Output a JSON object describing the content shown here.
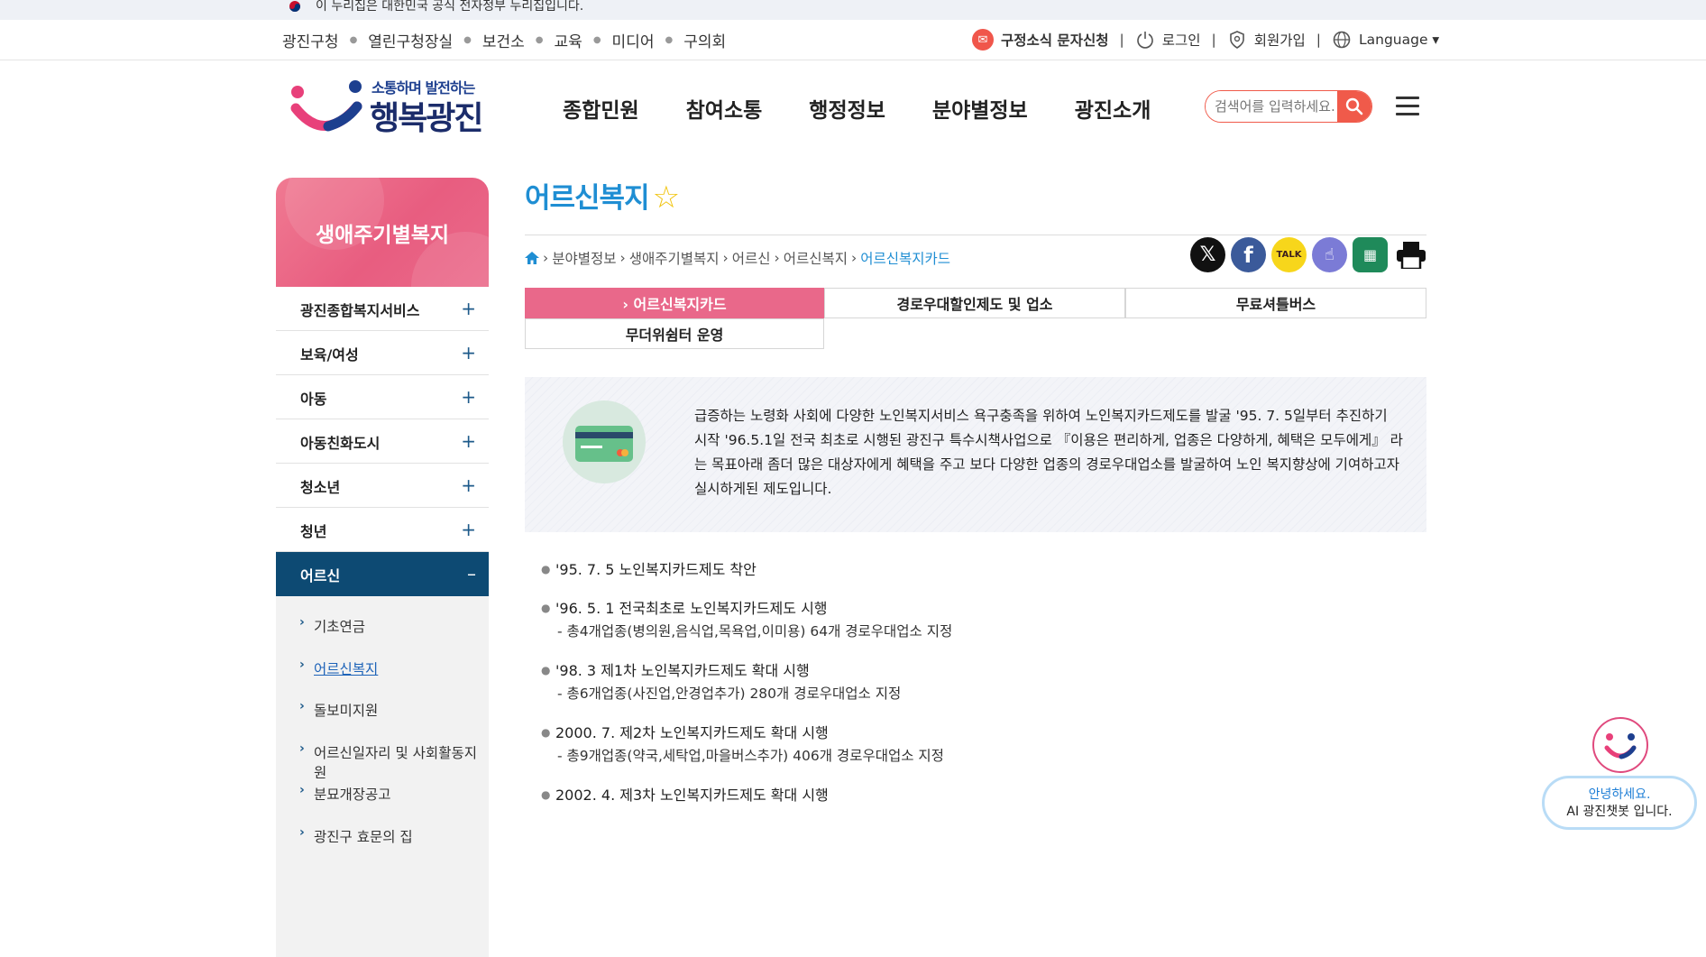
{
  "gov_banner": {
    "text": "이 누리집은 대한민국 공식 전자정부 누리집입니다."
  },
  "utility": {
    "left_links": [
      "광진구청",
      "열린구청장실",
      "보건소",
      "교육",
      "미디어",
      "구의회"
    ],
    "sms_label": "구정소식 문자신청",
    "login_label": "로그인",
    "signup_label": "회원가입",
    "language_label": "Language ▾"
  },
  "header": {
    "logo_tagline": "소통하며 발전하는",
    "logo_main": "행복광진",
    "gnb": [
      "종합민원",
      "참여소통",
      "행정정보",
      "분야별정보",
      "광진소개"
    ],
    "search_placeholder": "검색어를 입력하세요."
  },
  "sidebar": {
    "title": "생애주기별복지",
    "items": [
      {
        "label": "광진종합복지서비스",
        "toggle": "+"
      },
      {
        "label": "보육/여성",
        "toggle": "+"
      },
      {
        "label": "아동",
        "toggle": "+"
      },
      {
        "label": "아동친화도시",
        "toggle": "+"
      },
      {
        "label": "청소년",
        "toggle": "+"
      },
      {
        "label": "청년",
        "toggle": "+"
      },
      {
        "label": "어르신",
        "toggle": "–"
      }
    ],
    "sub_items": [
      "기초연금",
      "어르신복지",
      "돌보미지원",
      "어르신일자리 및 사회활동지원",
      "분묘개장공고",
      "광진구 효문의 집"
    ]
  },
  "content": {
    "title": "어르신복지",
    "breadcrumb": [
      "분야별정보",
      "생애주기별복지",
      "어르신",
      "어르신복지",
      "어르신복지카드"
    ],
    "share_icons": [
      "x-icon",
      "facebook-icon",
      "kakaotalk-icon",
      "touch-icon",
      "qr-icon",
      "print-icon"
    ],
    "tabs": [
      "› 어르신복지카드",
      "경로우대할인제도 및 업소",
      "무료셔틀버스",
      "무더위쉼터 운영"
    ],
    "intro": "급증하는 노령화 사회에 다양한 노인복지서비스 욕구충족을 위하여 노인복지카드제도를 발굴 '95. 7. 5일부터 추진하기 시작 '96.5.1일 전국 최초로 시행된 광진구 특수시책사업으로 『이용은 편리하게, 업종은 다양하게, 혜택은 모두에게』 라는 목표아래 좀더 많은 대상자에게 혜택을 주고 보다 다양한 업종의 경로우대업소를 발굴하여 노인 복지향상에 기여하고자 실시하게된 제도입니다.",
    "history": [
      {
        "title": "'95. 7. 5 노인복지카드제도 착안",
        "detail": ""
      },
      {
        "title": "'96. 5. 1 전국최초로 노인복지카드제도 시행",
        "detail": "- 총4개업종(병의원,음식업,목욕업,이미용) 64개 경로우대업소 지정"
      },
      {
        "title": "'98. 3 제1차 노인복지카드제도 확대 시행",
        "detail": "- 총6개업종(사진업,안경업추가) 280개 경로우대업소 지정"
      },
      {
        "title": "2000. 7. 제2차 노인복지카드제도 확대 시행",
        "detail": "- 총9개업종(약국,세탁업,마을버스추가) 406개 경로우대업소 지정"
      },
      {
        "title": "2002. 4. 제3차 노인복지카드제도 확대 시행",
        "detail": ""
      }
    ]
  },
  "chatbot": {
    "line1": "안녕하세요.",
    "line2": "AI 광진챗봇 입니다."
  },
  "colors": {
    "accent_blue": "#1f8ed3",
    "accent_pink": "#e9688a",
    "sidebar_active": "#0d4a73",
    "search_red": "#f05a4a"
  }
}
